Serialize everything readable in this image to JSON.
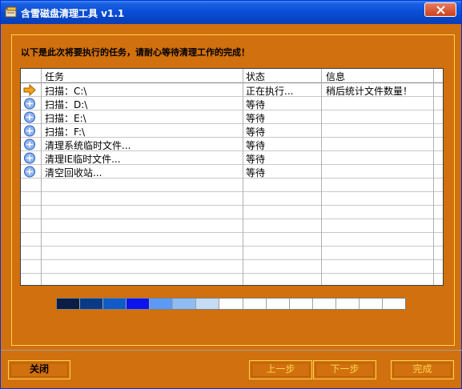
{
  "window": {
    "title": "含雪磁盘清理工具 v1.1"
  },
  "instruction": "以下是此次将要执行的任务，请耐心等待清理工作的完成！",
  "columns": {
    "task": "任务",
    "status": "状态",
    "info": "信息"
  },
  "tasks": [
    {
      "icon": "arrow-right-icon",
      "task": "扫描：C:\\",
      "status": "正在执行...",
      "info": "稍后统计文件数量！"
    },
    {
      "icon": "pending-icon",
      "task": "扫描：D:\\",
      "status": "等待",
      "info": ""
    },
    {
      "icon": "pending-icon",
      "task": "扫描：E:\\",
      "status": "等待",
      "info": ""
    },
    {
      "icon": "pending-icon",
      "task": "扫描：F:\\",
      "status": "等待",
      "info": ""
    },
    {
      "icon": "pending-icon",
      "task": "清理系统临时文件...",
      "status": "等待",
      "info": ""
    },
    {
      "icon": "pending-icon",
      "task": "清理IE临时文件...",
      "status": "等待",
      "info": ""
    },
    {
      "icon": "pending-icon",
      "task": "清空回收站...",
      "status": "等待",
      "info": ""
    }
  ],
  "progress": {
    "segments": [
      "#0b1d44",
      "#0a3a86",
      "#0f5bc8",
      "#0b14ee",
      "#5c9af5",
      "#8fbcf3",
      "#c5dbf6",
      "#ffffff",
      "#ffffff",
      "#ffffff",
      "#ffffff",
      "#ffffff",
      "#ffffff",
      "#ffffff",
      "#ffffff"
    ]
  },
  "buttons": {
    "close": "关闭",
    "prev": "上一步",
    "next": "下一步",
    "finish": "完成"
  },
  "colors": {
    "background": "#D0700E",
    "accent": "#FFD44A"
  }
}
